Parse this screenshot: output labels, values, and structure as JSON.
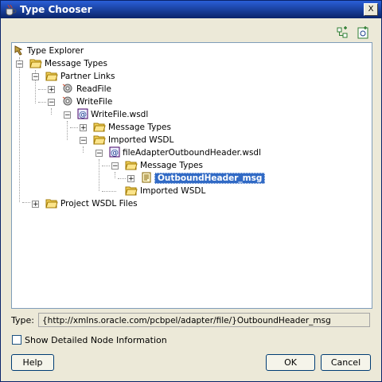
{
  "window": {
    "title": "Type Chooser",
    "close_label": "X"
  },
  "tree": {
    "nodes": [
      {
        "label": "Type Explorer"
      },
      {
        "label": "Message Types"
      },
      {
        "label": "Partner Links"
      },
      {
        "label": "ReadFile"
      },
      {
        "label": "WriteFile"
      },
      {
        "label": "WriteFile.wsdl"
      },
      {
        "label": "Message Types"
      },
      {
        "label": "Imported WSDL"
      },
      {
        "label": "fileAdapterOutboundHeader.wsdl"
      },
      {
        "label": "Message Types"
      },
      {
        "label": "OutboundHeader_msg"
      },
      {
        "label": "Imported WSDL"
      },
      {
        "label": "Project WSDL Files"
      }
    ]
  },
  "type_field": {
    "label": "Type:",
    "value": "{http://xmlns.oracle.com/pcbpel/adapter/file/}OutboundHeader_msg"
  },
  "checkbox": {
    "label": "Show Detailed Node Information",
    "checked": false
  },
  "buttons": {
    "help": "Help",
    "ok": "OK",
    "cancel": "Cancel"
  },
  "colors": {
    "selection": "#316ac5",
    "titlebar": "#0a246a",
    "folder": "#f4d35e"
  }
}
